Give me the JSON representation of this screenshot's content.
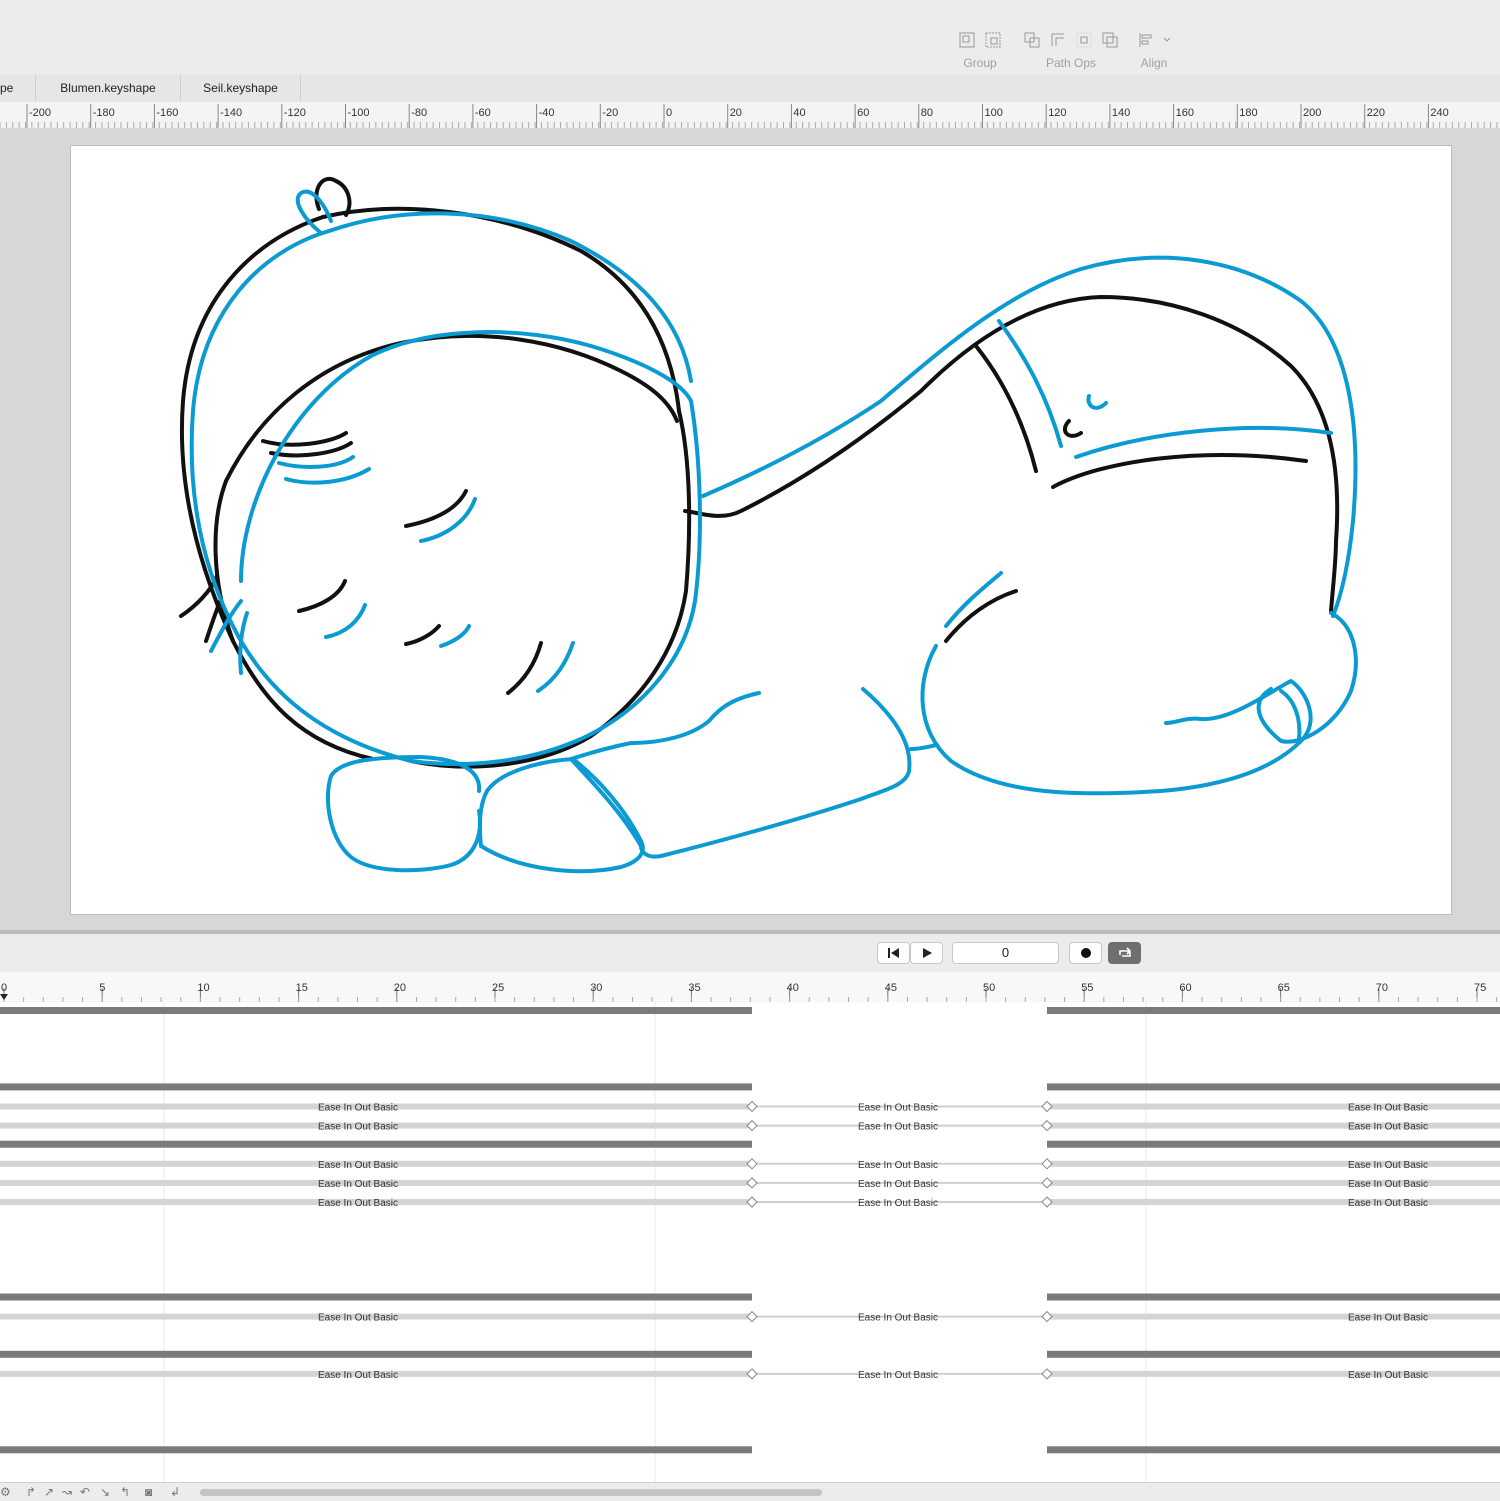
{
  "toolbar": {
    "groups": [
      {
        "label": "Group",
        "icons": [
          "group-icon",
          "ungroup-icon"
        ]
      },
      {
        "label": "Path Ops",
        "icons": [
          "path-union-icon",
          "path-subtract-icon",
          "path-intersect-icon",
          "path-exclude-icon"
        ]
      },
      {
        "label": "Align",
        "icons": [
          "align-left-icon",
          "chevron-down-icon"
        ]
      }
    ]
  },
  "tabs": [
    "pe",
    "Blumen.keyshape",
    "Seil.keyshape"
  ],
  "ruler": {
    "ticks": [
      "-200",
      "-180",
      "-160",
      "-140",
      "-120",
      "-100",
      "-80",
      "-60",
      "-40",
      "-20",
      "0",
      "20",
      "40",
      "60",
      "80",
      "100",
      "120",
      "140",
      "160",
      "180",
      "200",
      "220",
      "240"
    ]
  },
  "canvas": {
    "colors": {
      "outline": "#111111",
      "highlight": "#0b9bd2"
    }
  },
  "transport": {
    "frame_value": "0",
    "icons": [
      "skip-to-start-icon",
      "play-icon",
      "record-icon",
      "loop-icon"
    ]
  },
  "timeline": {
    "ticks": [
      "0",
      "5",
      "10",
      "15",
      "20",
      "25",
      "30",
      "35",
      "40",
      "45",
      "50",
      "55",
      "60",
      "65",
      "70",
      "75"
    ],
    "ease_label": "Ease In Out Basic",
    "rows": [
      {
        "kind": "group"
      },
      {
        "kind": "empty"
      },
      {
        "kind": "empty"
      },
      {
        "kind": "empty"
      },
      {
        "kind": "group"
      },
      {
        "kind": "ease"
      },
      {
        "kind": "ease"
      },
      {
        "kind": "group"
      },
      {
        "kind": "ease"
      },
      {
        "kind": "ease"
      },
      {
        "kind": "ease"
      },
      {
        "kind": "empty"
      },
      {
        "kind": "empty"
      },
      {
        "kind": "empty"
      },
      {
        "kind": "empty"
      },
      {
        "kind": "group"
      },
      {
        "kind": "ease"
      },
      {
        "kind": "empty"
      },
      {
        "kind": "group"
      },
      {
        "kind": "ease"
      },
      {
        "kind": "empty"
      },
      {
        "kind": "empty"
      },
      {
        "kind": "empty"
      },
      {
        "kind": "group"
      }
    ]
  },
  "bottom_icons": [
    "settings-icon",
    "curve-icon",
    "curve-icon",
    "curve-icon",
    "curve-icon",
    "curve-icon",
    "curve-icon",
    "graph-editor-icon",
    "loop-back-icon"
  ]
}
